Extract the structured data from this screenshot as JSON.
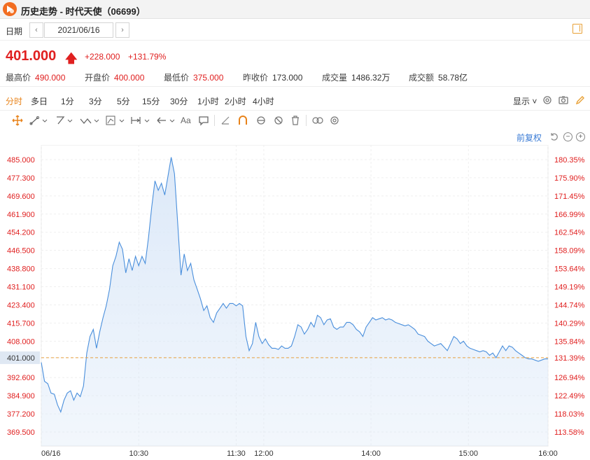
{
  "window": {
    "title": "历史走势 - 时代天使（06699）"
  },
  "date_bar": {
    "label": "日期",
    "value": "2021/06/16",
    "prev": "‹",
    "next": "›"
  },
  "quote": {
    "price": "401.000",
    "change": "+228.000",
    "change_pct": "+131.79%",
    "stats": [
      {
        "key": "最高价",
        "value": "490.000",
        "tone": "red"
      },
      {
        "key": "开盘价",
        "value": "400.000",
        "tone": "red"
      },
      {
        "key": "最低价",
        "value": "375.000",
        "tone": "red"
      },
      {
        "key": "昨收价",
        "value": "173.000",
        "tone": "dark"
      },
      {
        "key": "成交量",
        "value": "1486.32万",
        "tone": "dark"
      },
      {
        "key": "成交额",
        "value": "58.78亿",
        "tone": "dark"
      }
    ]
  },
  "periods": [
    "分时",
    "多日",
    "1分",
    "3分",
    "5分",
    "15分",
    "30分",
    "1小时",
    "2小时",
    "4小时"
  ],
  "display_label": "显示",
  "toolbar": {
    "text_tool": "Aa"
  },
  "chart_options": {
    "adjust": "前复权"
  },
  "colors": {
    "accent": "#e8831a",
    "up": "#e02020",
    "line": "#4a8fdc",
    "fill": "#dbe8f8",
    "reference": "#e8a040"
  },
  "chart_data": {
    "type": "area",
    "title": "",
    "previous_close": 173.0,
    "reference_price": 401.0,
    "y_ticks_price": [
      "485.000",
      "477.300",
      "469.600",
      "461.900",
      "454.200",
      "446.500",
      "438.800",
      "431.100",
      "423.400",
      "415.700",
      "408.000",
      "401.000",
      "392.600",
      "384.900",
      "377.200",
      "369.500"
    ],
    "y_ticks_pct": [
      "180.35%",
      "175.90%",
      "171.45%",
      "166.99%",
      "162.54%",
      "158.09%",
      "153.64%",
      "149.19%",
      "144.74%",
      "140.29%",
      "135.84%",
      "131.39%",
      "126.94%",
      "122.49%",
      "118.03%",
      "113.58%"
    ],
    "x_ticks": [
      "06/16",
      "10:30",
      "11:30",
      "12:00",
      "14:00",
      "15:00",
      "16:00"
    ],
    "ylim": [
      363.7,
      491.0
    ],
    "series": [
      {
        "values": [
          [
            0,
            399.0
          ],
          [
            2,
            391.0
          ],
          [
            4,
            390.0
          ],
          [
            6,
            386.0
          ],
          [
            8,
            385.5
          ],
          [
            10,
            381.0
          ],
          [
            12,
            378.0
          ],
          [
            14,
            383.0
          ],
          [
            16,
            386.0
          ],
          [
            18,
            387.0
          ],
          [
            20,
            383.0
          ],
          [
            22,
            386.0
          ],
          [
            24,
            384.5
          ],
          [
            26,
            389.0
          ],
          [
            28,
            403.0
          ],
          [
            30,
            410.0
          ],
          [
            32,
            413.0
          ],
          [
            34,
            405.0
          ],
          [
            36,
            412.0
          ],
          [
            38,
            418.0
          ],
          [
            40,
            423.0
          ],
          [
            42,
            430.0
          ],
          [
            44,
            440.0
          ],
          [
            46,
            444.0
          ],
          [
            48,
            450.0
          ],
          [
            50,
            447.0
          ],
          [
            52,
            437.0
          ],
          [
            54,
            443.0
          ],
          [
            56,
            438.0
          ],
          [
            58,
            444.0
          ],
          [
            60,
            440.0
          ],
          [
            62,
            444.0
          ],
          [
            64,
            441.0
          ],
          [
            66,
            452.0
          ],
          [
            68,
            465.0
          ],
          [
            70,
            476.0
          ],
          [
            72,
            472.0
          ],
          [
            74,
            475.0
          ],
          [
            76,
            470.0
          ],
          [
            78,
            478.0
          ],
          [
            80,
            486.0
          ],
          [
            82,
            479.0
          ],
          [
            84,
            458.0
          ],
          [
            86,
            436.0
          ],
          [
            88,
            445.0
          ],
          [
            90,
            438.0
          ],
          [
            92,
            441.0
          ],
          [
            94,
            434.0
          ],
          [
            96,
            430.0
          ],
          [
            98,
            426.0
          ],
          [
            100,
            421.0
          ],
          [
            102,
            423.0
          ],
          [
            104,
            418.0
          ],
          [
            106,
            416.0
          ],
          [
            108,
            420.0
          ],
          [
            110,
            422.0
          ],
          [
            112,
            424.0
          ],
          [
            114,
            422.0
          ],
          [
            116,
            424.0
          ],
          [
            118,
            424.0
          ],
          [
            120,
            423.0
          ],
          [
            122,
            424.0
          ],
          [
            124,
            423.0
          ],
          [
            126,
            410.0
          ],
          [
            128,
            404.0
          ],
          [
            130,
            407.0
          ],
          [
            132,
            416.0
          ],
          [
            134,
            410.0
          ],
          [
            136,
            407.0
          ],
          [
            138,
            409.0
          ],
          [
            140,
            406.5
          ],
          [
            142,
            405.0
          ],
          [
            144,
            405.0
          ],
          [
            146,
            404.5
          ],
          [
            148,
            406.0
          ],
          [
            150,
            405.0
          ],
          [
            152,
            405.0
          ],
          [
            154,
            406.0
          ],
          [
            156,
            410.0
          ],
          [
            158,
            415.0
          ],
          [
            160,
            414.0
          ],
          [
            162,
            411.0
          ],
          [
            164,
            413.0
          ],
          [
            166,
            416.0
          ],
          [
            168,
            414.0
          ],
          [
            170,
            419.0
          ],
          [
            172,
            418.0
          ],
          [
            174,
            415.0
          ],
          [
            176,
            417.0
          ],
          [
            178,
            417.5
          ],
          [
            180,
            414.0
          ],
          [
            182,
            413.0
          ],
          [
            184,
            414.0
          ],
          [
            186,
            414.0
          ],
          [
            188,
            416.0
          ],
          [
            190,
            416.0
          ],
          [
            192,
            415.0
          ],
          [
            194,
            413.0
          ],
          [
            196,
            412.0
          ],
          [
            198,
            410.0
          ],
          [
            200,
            414.0
          ],
          [
            202,
            416.0
          ],
          [
            204,
            418.0
          ],
          [
            206,
            417.0
          ],
          [
            208,
            417.5
          ],
          [
            210,
            418.0
          ],
          [
            212,
            417.0
          ],
          [
            214,
            417.5
          ],
          [
            216,
            417.0
          ],
          [
            218,
            416.0
          ],
          [
            220,
            415.5
          ],
          [
            222,
            415.0
          ],
          [
            224,
            414.5
          ],
          [
            226,
            415.0
          ],
          [
            228,
            414.0
          ],
          [
            230,
            413.0
          ],
          [
            232,
            411.0
          ],
          [
            234,
            410.5
          ],
          [
            236,
            410.0
          ],
          [
            238,
            408.0
          ],
          [
            240,
            407.0
          ],
          [
            242,
            406.0
          ],
          [
            244,
            406.5
          ],
          [
            246,
            407.0
          ],
          [
            248,
            405.5
          ],
          [
            250,
            404.0
          ],
          [
            252,
            407.0
          ],
          [
            254,
            410.0
          ],
          [
            256,
            409.0
          ],
          [
            258,
            407.0
          ],
          [
            260,
            408.0
          ],
          [
            262,
            406.0
          ],
          [
            264,
            405.0
          ],
          [
            266,
            404.5
          ],
          [
            268,
            404.0
          ],
          [
            270,
            403.5
          ],
          [
            272,
            404.0
          ],
          [
            274,
            403.5
          ],
          [
            276,
            402.0
          ],
          [
            278,
            403.0
          ],
          [
            280,
            401.0
          ],
          [
            282,
            403.5
          ],
          [
            284,
            406.0
          ],
          [
            286,
            404.0
          ],
          [
            288,
            406.0
          ],
          [
            290,
            405.5
          ],
          [
            292,
            404.0
          ],
          [
            294,
            403.0
          ],
          [
            296,
            402.0
          ],
          [
            298,
            401.0
          ],
          [
            300,
            400.5
          ],
          [
            302,
            400.5
          ],
          [
            304,
            400.0
          ],
          [
            306,
            399.5
          ],
          [
            308,
            400.0
          ],
          [
            310,
            400.5
          ],
          [
            312,
            400.5
          ]
        ]
      }
    ],
    "x_tick_minutes": [
      0,
      60,
      120,
      137,
      203,
      263,
      312
    ]
  }
}
